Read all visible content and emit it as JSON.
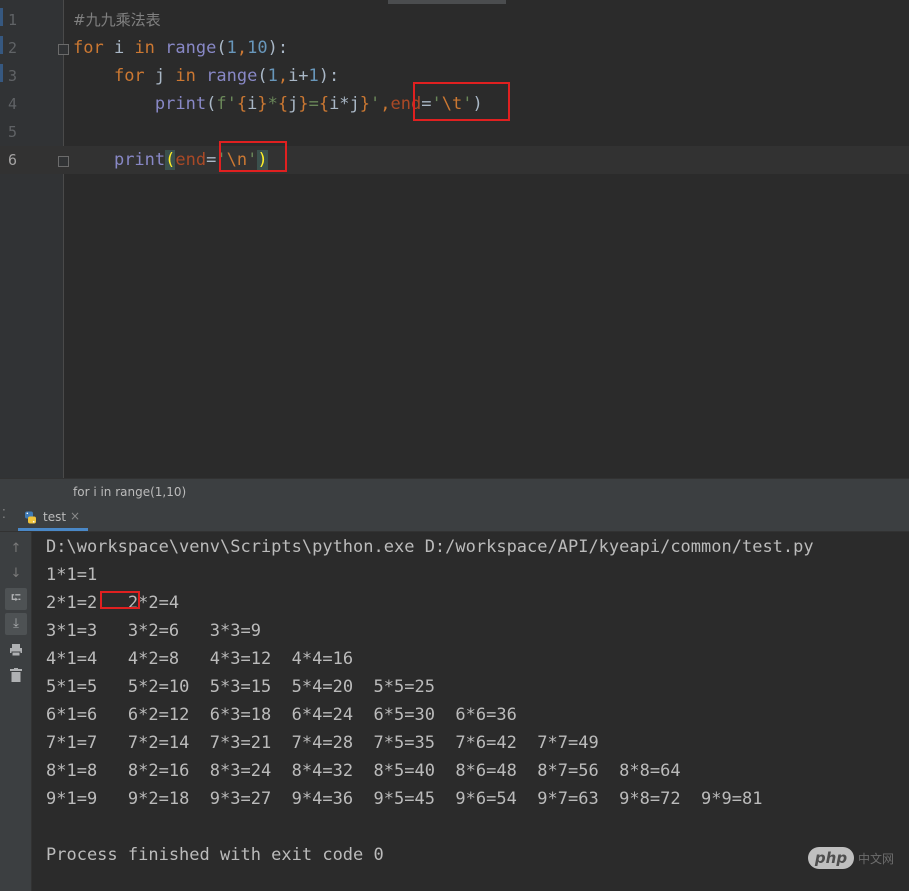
{
  "editor": {
    "line_numbers": [
      "1",
      "2",
      "3",
      "4",
      "5",
      "6"
    ],
    "lines": [
      [
        {
          "t": "#九九乘法表",
          "c": "com"
        }
      ],
      [
        {
          "t": "for",
          "c": "kw"
        },
        {
          "t": " i ",
          "c": ""
        },
        {
          "t": "in",
          "c": "kw"
        },
        {
          "t": " ",
          "c": ""
        },
        {
          "t": "range",
          "c": "bi"
        },
        {
          "t": "(",
          "c": ""
        },
        {
          "t": "1",
          "c": "num"
        },
        {
          "t": ",",
          "c": "kw"
        },
        {
          "t": "10",
          "c": "num"
        },
        {
          "t": "):",
          "c": ""
        }
      ],
      [
        {
          "t": "    ",
          "c": ""
        },
        {
          "t": "for",
          "c": "kw"
        },
        {
          "t": " j ",
          "c": ""
        },
        {
          "t": "in",
          "c": "kw"
        },
        {
          "t": " ",
          "c": ""
        },
        {
          "t": "range",
          "c": "bi"
        },
        {
          "t": "(",
          "c": ""
        },
        {
          "t": "1",
          "c": "num"
        },
        {
          "t": ",",
          "c": "kw"
        },
        {
          "t": "i+",
          "c": ""
        },
        {
          "t": "1",
          "c": "num"
        },
        {
          "t": "):",
          "c": ""
        }
      ],
      [
        {
          "t": "        ",
          "c": ""
        },
        {
          "t": "print",
          "c": "bi"
        },
        {
          "t": "(",
          "c": ""
        },
        {
          "t": "f'",
          "c": "str"
        },
        {
          "t": "{",
          "c": "kw"
        },
        {
          "t": "i",
          "c": ""
        },
        {
          "t": "}",
          "c": "kw"
        },
        {
          "t": "*",
          "c": "str"
        },
        {
          "t": "{",
          "c": "kw"
        },
        {
          "t": "j",
          "c": ""
        },
        {
          "t": "}",
          "c": "kw"
        },
        {
          "t": "=",
          "c": "str"
        },
        {
          "t": "{",
          "c": "kw"
        },
        {
          "t": "i*j",
          "c": ""
        },
        {
          "t": "}",
          "c": "kw"
        },
        {
          "t": "'",
          "c": "str"
        },
        {
          "t": ",",
          "c": "kw"
        },
        {
          "t": "end",
          "c": "par"
        },
        {
          "t": "=",
          "c": ""
        },
        {
          "t": "'",
          "c": "str"
        },
        {
          "t": "\\t",
          "c": "esc"
        },
        {
          "t": "'",
          "c": "str"
        },
        {
          "t": ")",
          "c": ""
        }
      ],
      [],
      [
        {
          "t": "    ",
          "c": ""
        },
        {
          "t": "print",
          "c": "bi"
        },
        {
          "t": "(",
          "c": "cur-par"
        },
        {
          "t": "end",
          "c": "par"
        },
        {
          "t": "=",
          "c": ""
        },
        {
          "t": "'",
          "c": "str"
        },
        {
          "t": "\\n",
          "c": "esc"
        },
        {
          "t": "'",
          "c": "str"
        },
        {
          "t": ")",
          "c": "cur-par"
        }
      ]
    ],
    "breadcrumb": "for i in range(1,10)"
  },
  "run_panel": {
    "tab_label": "test",
    "tab_close": "×",
    "tab_icon": "python-icon",
    "tools": [
      "up-arrow-icon",
      "down-arrow-icon",
      "soft-wrap-icon",
      "scroll-to-end-icon",
      "print-icon",
      "trash-icon"
    ],
    "output": [
      "D:\\workspace\\venv\\Scripts\\python.exe D:/workspace/API/kyeapi/common/test.py",
      "1*1=1\t",
      "2*1=2\t2*2=4\t",
      "3*1=3\t3*2=6\t3*3=9\t",
      "4*1=4\t4*2=8\t4*3=12\t4*4=16\t",
      "5*1=5\t5*2=10\t5*3=15\t5*4=20\t5*5=25\t",
      "6*1=6\t6*2=12\t6*3=18\t6*4=24\t6*5=30\t6*6=36\t",
      "7*1=7\t7*2=14\t7*3=21\t7*4=28\t7*5=35\t7*6=42\t7*7=49\t",
      "8*1=8\t8*2=16\t8*3=24\t8*4=32\t8*5=40\t8*6=48\t8*7=56\t8*8=64\t",
      "9*1=9\t9*2=18\t9*3=27\t9*4=36\t9*5=45\t9*6=54\t9*7=63\t9*8=72\t9*9=81\t",
      "",
      "Process finished with exit code 0"
    ]
  },
  "watermark": {
    "logo": "php",
    "text": "中文网"
  },
  "colors": {
    "annotation_box": "#e02020",
    "keyword": "#cc7832",
    "number": "#6897bb",
    "string": "#6a8759",
    "builtin": "#8888c6"
  }
}
